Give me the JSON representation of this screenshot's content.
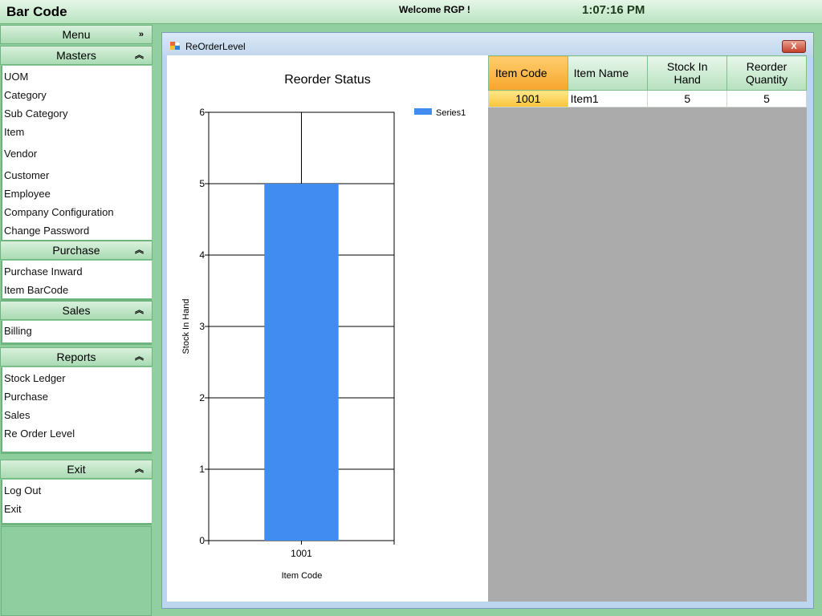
{
  "app": {
    "title": "Bar Code",
    "welcome": "Welcome RGP !",
    "time": "1:07:16 PM"
  },
  "sidebar": {
    "menu_label": "Menu",
    "sections": [
      {
        "label": "Masters",
        "items": [
          "UOM",
          "Category",
          "Sub Category",
          "Item",
          "Vendor",
          "Customer",
          "Employee",
          "Company Configuration",
          "Change Password"
        ]
      },
      {
        "label": "Purchase",
        "items": [
          "Purchase Inward",
          "Item BarCode"
        ]
      },
      {
        "label": "Sales",
        "items": [
          "Billing"
        ]
      },
      {
        "label": "Reports",
        "items": [
          "Stock Ledger",
          "Purchase",
          "Sales",
          "Re Order Level"
        ]
      },
      {
        "label": "Exit",
        "items": [
          "Log Out",
          "Exit"
        ]
      }
    ],
    "expand_glyph": "»",
    "collapse_glyph": "«"
  },
  "window": {
    "title": "ReOrderLevel",
    "close_label": "X"
  },
  "grid": {
    "columns": [
      "Item Code",
      "Item Name",
      "Stock In Hand",
      "Reorder Quantity"
    ],
    "rows": [
      [
        "1001",
        "Item1",
        "5",
        "5"
      ]
    ]
  },
  "chart_data": {
    "type": "bar",
    "title": "Reorder Status",
    "xlabel": "Item Code",
    "ylabel": "Stock In Hand",
    "categories": [
      "1001"
    ],
    "series": [
      {
        "name": "Series1",
        "values": [
          5
        ],
        "color": "#418cf0"
      }
    ],
    "ylim": [
      0,
      6
    ],
    "yticks": [
      0,
      1,
      2,
      3,
      4,
      5,
      6
    ],
    "grid": true,
    "legend_position": "top-right"
  },
  "colors": {
    "accent_green": "#8fcf9f",
    "selected_orange": "#f7a52c",
    "bar_blue": "#418cf0"
  }
}
